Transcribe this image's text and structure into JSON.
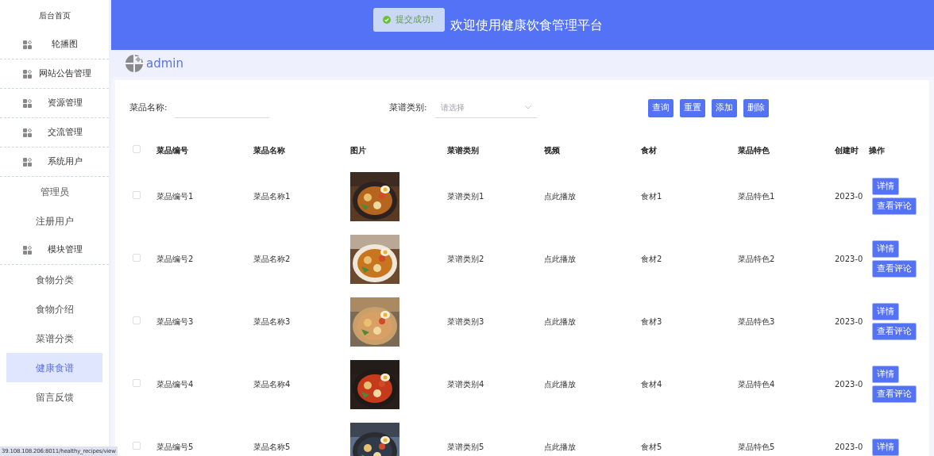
{
  "toast": {
    "text": "提交成功!"
  },
  "header": {
    "title": "欢迎使用健康饮食管理平台"
  },
  "user": {
    "name": "admin"
  },
  "sidebar": {
    "home": "后台首页",
    "items": [
      {
        "label": "轮播图"
      },
      {
        "label": "网站公告管理"
      },
      {
        "label": "资源管理"
      },
      {
        "label": "交流管理"
      },
      {
        "label": "系统用户",
        "children": [
          {
            "label": "管理员",
            "selected": false
          },
          {
            "label": "注册用户",
            "selected": false
          }
        ]
      },
      {
        "label": "模块管理",
        "children": [
          {
            "label": "食物分类",
            "selected": false
          },
          {
            "label": "食物介绍",
            "selected": false
          },
          {
            "label": "菜谱分类",
            "selected": false
          },
          {
            "label": "健康食谱",
            "selected": true
          },
          {
            "label": "留言反馈",
            "selected": false
          }
        ]
      }
    ]
  },
  "filters": {
    "name_label": "菜品名称:",
    "category_label": "菜谱类别:",
    "category_placeholder": "请选择",
    "buttons": [
      "查询",
      "重置",
      "添加",
      "删除"
    ]
  },
  "table": {
    "all_checked": false,
    "columns": [
      "菜品编号",
      "菜品名称",
      "图片",
      "菜谱类别",
      "视频",
      "食材",
      "菜品特色",
      "创建时",
      "操作"
    ],
    "rows": [
      {
        "checked": false,
        "cells": [
          "菜品编号1",
          "菜品名称1",
          {
            "kind": "picture"
          },
          "菜谱类别1",
          "点此播放",
          "食材1",
          "菜品特色1",
          "2023-0"
        ],
        "actions": [
          "详情",
          "查看评论"
        ]
      },
      {
        "checked": false,
        "cells": [
          "菜品编号2",
          "菜品名称2",
          {
            "kind": "picture"
          },
          "菜谱类别2",
          "点此播放",
          "食材2",
          "菜品特色2",
          "2023-0"
        ],
        "actions": [
          "详情",
          "查看评论"
        ]
      },
      {
        "checked": false,
        "cells": [
          "菜品编号3",
          "菜品名称3",
          {
            "kind": "picture"
          },
          "菜谱类别3",
          "点此播放",
          "食材3",
          "菜品特色3",
          "2023-0"
        ],
        "actions": [
          "详情",
          "查看评论"
        ]
      },
      {
        "checked": false,
        "cells": [
          "菜品编号4",
          "菜品名称4",
          {
            "kind": "picture"
          },
          "菜谱类别4",
          "点此播放",
          "食材4",
          "菜品特色4",
          "2023-0"
        ],
        "actions": [
          "详情",
          "查看评论"
        ]
      },
      {
        "checked": false,
        "cells": [
          "菜品编号5",
          "菜品名称5",
          {
            "kind": "picture"
          },
          "菜谱类别5",
          "点此播放",
          "食材5",
          "菜品特色5",
          "2023-0"
        ],
        "actions": [
          "详情"
        ]
      }
    ]
  },
  "status_url": "39.108.108.206:8011/healthy_recipes/view"
}
